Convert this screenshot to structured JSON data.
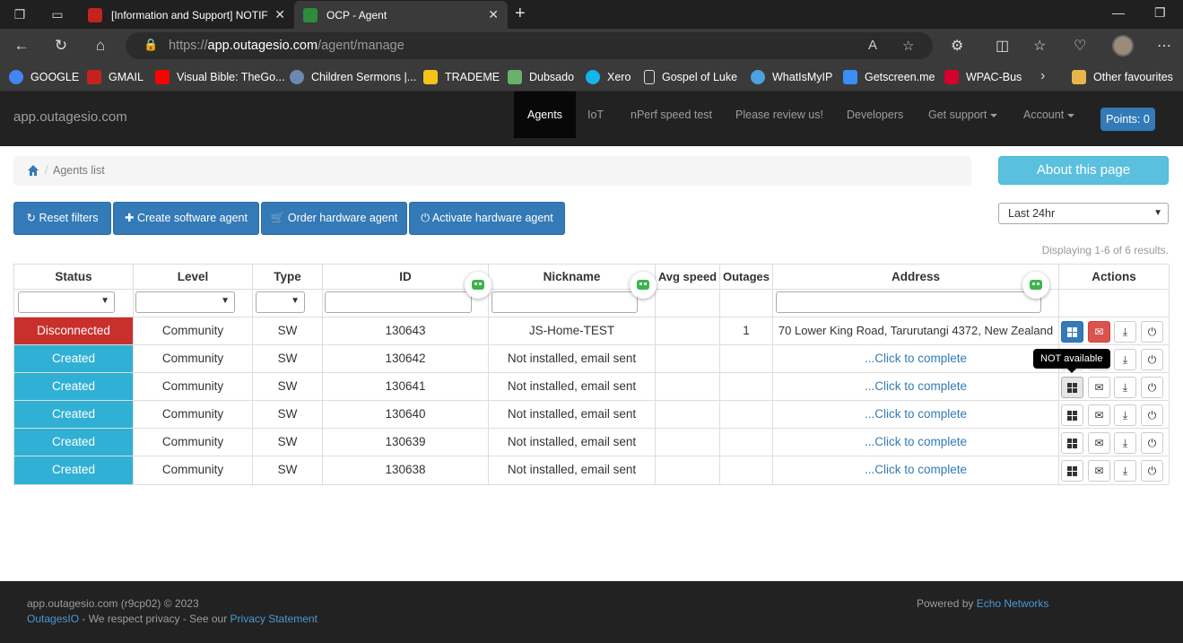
{
  "browser": {
    "tabs": [
      {
        "title": "[Information and Support] NOTIF",
        "favicon_color": "#c5221f"
      },
      {
        "title": "OCP - Agent",
        "favicon_color": "#2c8c3c"
      }
    ],
    "url_prefix": "https://",
    "url_host": "app.outagesio.com",
    "url_path": "/agent/manage",
    "bookmarks": [
      {
        "label": "GOOGLE",
        "color": "#4285f4"
      },
      {
        "label": "GMAIL",
        "color": "#c5221f"
      },
      {
        "label": "Visual Bible: TheGo...",
        "color": "#ff0000"
      },
      {
        "label": "Children Sermons |...",
        "color": "#6a8ab0"
      },
      {
        "label": "TRADEME",
        "color": "#f3c317"
      },
      {
        "label": "Dubsado",
        "color": "#6ab06a"
      },
      {
        "label": "Xero",
        "color": "#13b5ea"
      },
      {
        "label": "Gospel of Luke",
        "color": "#dddddd"
      },
      {
        "label": "WhatIsMyIP",
        "color": "#4aa3df"
      },
      {
        "label": "Getscreen.me",
        "color": "#3a8ef6"
      },
      {
        "label": "WPAC-Bus",
        "color": "#d5002b"
      }
    ],
    "other_favourites": "Other favourites"
  },
  "navbar": {
    "brand": "app.outagesio.com",
    "items": [
      "Agents",
      "IoT",
      "nPerf speed test",
      "Please review us!",
      "Developers",
      "Get support",
      "Account"
    ],
    "points": "Points: 0"
  },
  "breadcrumb": {
    "current": "Agents list"
  },
  "about_button": "About this page",
  "actions": {
    "reset": "Reset filters",
    "create_sw": "Create software agent",
    "order_hw": "Order hardware agent",
    "activate_hw": "Activate hardware agent"
  },
  "time_range": {
    "selected": "Last 24hr"
  },
  "displaying": "Displaying 1-6 of 6 results.",
  "table": {
    "columns": [
      "Status",
      "Level",
      "Type",
      "ID",
      "Nickname",
      "Avg speed",
      "Outages",
      "Address",
      "Actions"
    ],
    "rows": [
      {
        "status": "Disconnected",
        "level": "Community",
        "type": "SW",
        "id": "130643",
        "nickname": "JS-Home-TEST",
        "avg_speed": "",
        "outages": "1",
        "address": "70 Lower King Road, Tarurutangi 4372, New Zealand"
      },
      {
        "status": "Created",
        "level": "Community",
        "type": "SW",
        "id": "130642",
        "nickname": "Not installed, email sent",
        "avg_speed": "",
        "outages": "",
        "address": "...Click to complete"
      },
      {
        "status": "Created",
        "level": "Community",
        "type": "SW",
        "id": "130641",
        "nickname": "Not installed, email sent",
        "avg_speed": "",
        "outages": "",
        "address": "...Click to complete"
      },
      {
        "status": "Created",
        "level": "Community",
        "type": "SW",
        "id": "130640",
        "nickname": "Not installed, email sent",
        "avg_speed": "",
        "outages": "",
        "address": "...Click to complete"
      },
      {
        "status": "Created",
        "level": "Community",
        "type": "SW",
        "id": "130639",
        "nickname": "Not installed, email sent",
        "avg_speed": "",
        "outages": "",
        "address": "...Click to complete"
      },
      {
        "status": "Created",
        "level": "Community",
        "type": "SW",
        "id": "130638",
        "nickname": "Not installed, email sent",
        "avg_speed": "",
        "outages": "",
        "address": "...Click to complete"
      }
    ],
    "tooltip": "NOT available"
  },
  "footer": {
    "line1": "app.outagesio.com (r9cp02) © 2023",
    "outagesio_link": "OutagesIO",
    "privacy_text": " - We respect privacy - See our ",
    "privacy_link": "Privacy Statement",
    "powered_by": "Powered by ",
    "echo_link": "Echo Networks"
  },
  "colors": {
    "disconnected": "#c9302c",
    "created": "#31b0d5",
    "primary": "#337ab7",
    "info": "#5bc0de"
  }
}
